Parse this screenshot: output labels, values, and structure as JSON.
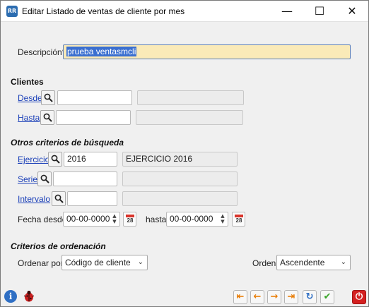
{
  "window": {
    "title": "Editar Listado de ventas de cliente por mes",
    "app_icon_text": "RR",
    "minimize": "—",
    "maximize": "☐",
    "close": "✕"
  },
  "descripcion": {
    "label": "Descripción*",
    "value": "prueba ventasmcli"
  },
  "clientes": {
    "section": "Clientes",
    "desde": {
      "label": "Desde",
      "value": "",
      "name": ""
    },
    "hasta": {
      "label": "Hasta",
      "value": "",
      "name": ""
    }
  },
  "otros": {
    "section": "Otros criterios de búsqueda",
    "ejercicio": {
      "label": "Ejercicio",
      "value": "2016",
      "name": "EJERCICIO 2016"
    },
    "serie": {
      "label": "Serie",
      "value": "",
      "name": ""
    },
    "intervalo": {
      "label": "Intervalo",
      "value": "",
      "name": ""
    },
    "fecha_desde": {
      "label": "Fecha desde",
      "value": "00-00-0000"
    },
    "fecha_hasta": {
      "label": "hasta",
      "value": "00-00-0000"
    },
    "calendar_day": "28"
  },
  "orden": {
    "section": "Criterios de ordenación",
    "ordenar_por": {
      "label": "Ordenar por",
      "selected": "Código de cliente"
    },
    "orden": {
      "label": "Orden",
      "selected": "Ascendente"
    }
  },
  "toolbar": {
    "first": "⇤",
    "prev": "←",
    "next": "→",
    "last": "⇥",
    "refresh": "↻",
    "accept": "✔",
    "exit": "⏻"
  },
  "colors": {
    "focus_bg": "#faeab8",
    "link": "#1a3fb8",
    "selection": "#3a6fd0"
  }
}
